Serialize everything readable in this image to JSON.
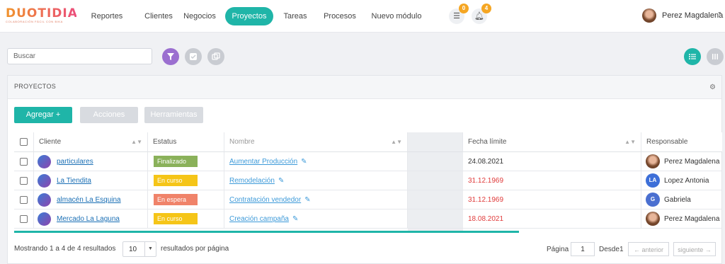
{
  "brand": {
    "logo_text": "DUOTIDIAN",
    "tagline": "COLABORACIÓN FÁCIL CON BIKA"
  },
  "nav": {
    "items": [
      {
        "label": "Reportes"
      },
      {
        "label": "Clientes"
      },
      {
        "label": "Negocios"
      },
      {
        "label": "Proyectos",
        "active": true
      },
      {
        "label": "Tareas"
      },
      {
        "label": "Procesos"
      },
      {
        "label": "Nuevo módulo"
      }
    ]
  },
  "notifications": {
    "messages_count": "0",
    "alerts_count": "4"
  },
  "user": {
    "name": "Perez Magdalena"
  },
  "search": {
    "placeholder": "Buscar"
  },
  "card": {
    "title": "PROYECTOS",
    "buttons": {
      "add": "Agregar +",
      "actions": "Acciones",
      "tools": "Herramientas"
    }
  },
  "table": {
    "headers": {
      "client": "Cliente",
      "status": "Estatus",
      "name": "Nombre",
      "due": "Fecha límite",
      "owner": "Responsable"
    },
    "rows": [
      {
        "client": "particulares",
        "status": "Finalizado",
        "status_color": "#8ab15a",
        "name": "Aumentar Producción",
        "due": "24.08.2021",
        "due_overdue": false,
        "owner": "Perez Magdalena",
        "owner_initials": "",
        "owner_color": "photo"
      },
      {
        "client": "La Tiendita",
        "status": "En curso",
        "status_color": "#f5c518",
        "name": "Remodelación",
        "due": "31.12.1969",
        "due_overdue": true,
        "owner": "Lopez Antonia",
        "owner_initials": "LA",
        "owner_color": "#3d6fd8"
      },
      {
        "client": "almacén La Esquina",
        "status": "En espera",
        "status_color": "#f0836a",
        "name": "Contratación vendedor",
        "due": "31.12.1969",
        "due_overdue": true,
        "owner": "Gabriela",
        "owner_initials": "G",
        "owner_color": "#4a6fd0"
      },
      {
        "client": "Mercado La Laguna",
        "status": "En curso",
        "status_color": "#f5c518",
        "name": "Creación campaña",
        "due": "18.08.2021",
        "due_overdue": true,
        "owner": "Perez Magdalena",
        "owner_initials": "",
        "owner_color": "photo"
      }
    ]
  },
  "footer": {
    "showing": "Mostrando 1 a 4 de 4 resultados",
    "page_size": "10",
    "per_page": "resultados por página",
    "page_label": "Página",
    "page_value": "1",
    "of_label": "Desde",
    "total_pages": "1",
    "prev": "← anterior",
    "next": "siguiente →"
  },
  "colors": {
    "accent": "#1fb5a8",
    "filter": "#9b6fd0",
    "overdue": "#e03b3b"
  }
}
